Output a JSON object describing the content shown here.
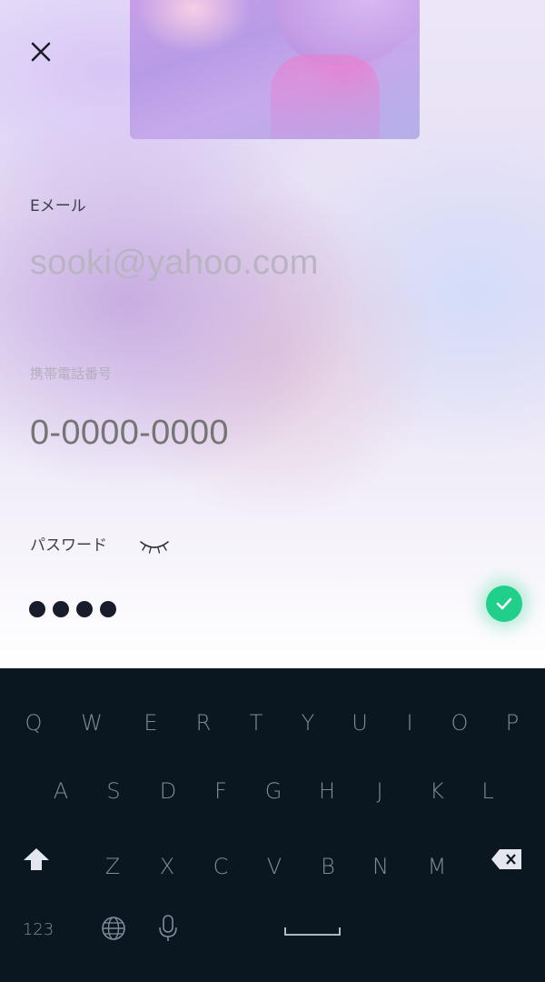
{
  "header": {
    "close_icon": "close-icon"
  },
  "form": {
    "email_label": "Eメール",
    "email_value": "sooki@yahoo.com",
    "phone_label": "携帯電話番号",
    "phone_placeholder": "0-0000-0000",
    "password_label": "パスワード",
    "password_masked_length": 4,
    "eye_icon": "eye-closed-icon",
    "confirm_icon": "check-icon",
    "accent_color": "#1fcf8a"
  },
  "keyboard": {
    "row1": [
      "Q",
      "W",
      "E",
      "R",
      "T",
      "Y",
      "U",
      "I",
      "O",
      "P"
    ],
    "row2": [
      "A",
      "S",
      "D",
      "F",
      "G",
      "H",
      "J",
      "K",
      "L"
    ],
    "row3": [
      "Z",
      "X",
      "C",
      "V",
      "B",
      "N",
      "M"
    ],
    "numbers_key": "123",
    "icons": [
      "shift-icon",
      "backspace-icon",
      "globe-icon",
      "microphone-icon",
      "space-bar"
    ],
    "background_color": "#0b1720"
  }
}
